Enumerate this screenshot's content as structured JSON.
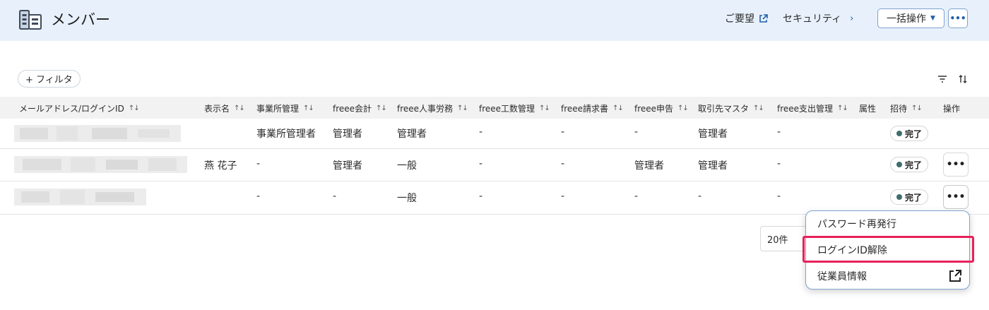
{
  "header": {
    "title": "メンバー",
    "request_label": "ご要望",
    "security_label": "セキュリティ",
    "bulk_label": "一括操作",
    "more_label": "•••"
  },
  "toolbar": {
    "filter_label": "+ フィルタ"
  },
  "table": {
    "columns": [
      {
        "label": "メールアドレス/ログインID",
        "sortable": true
      },
      {
        "label": "表示名",
        "sortable": true
      },
      {
        "label": "事業所管理",
        "sortable": true
      },
      {
        "label": "freee会計",
        "sortable": true
      },
      {
        "label": "freee人事労務",
        "sortable": true
      },
      {
        "label": "freee工数管理",
        "sortable": true
      },
      {
        "label": "freee請求書",
        "sortable": true
      },
      {
        "label": "freee申告",
        "sortable": true
      },
      {
        "label": "取引先マスタ",
        "sortable": true
      },
      {
        "label": "freee支出管理",
        "sortable": true
      },
      {
        "label": "属性",
        "sortable": false
      },
      {
        "label": "招待",
        "sortable": true
      },
      {
        "label": "操作",
        "sortable": false
      }
    ],
    "rows": [
      {
        "name": "",
        "office": "事業所管理者",
        "accounting": "管理者",
        "hr": "管理者",
        "workload": "-",
        "invoice": "-",
        "tax": "-",
        "partner": "管理者",
        "expense": "-",
        "status": "完了"
      },
      {
        "name": "燕 花子",
        "office": "-",
        "accounting": "管理者",
        "hr": "一般",
        "workload": "-",
        "invoice": "-",
        "tax": "管理者",
        "partner": "管理者",
        "expense": "-",
        "status": "完了"
      },
      {
        "name": "",
        "office": "-",
        "accounting": "-",
        "hr": "一般",
        "workload": "-",
        "invoice": "-",
        "tax": "-",
        "partner": "-",
        "expense": "-",
        "status": "完了"
      }
    ],
    "row_more_label": "•••"
  },
  "pagination": {
    "per_page": "20件"
  },
  "context_menu": {
    "items": [
      "パスワード再発行",
      "ログインID解除",
      "従業員情報"
    ]
  },
  "colors": {
    "header_bg": "#e8f1fb",
    "accent": "#1f5fa8",
    "highlight": "#e8205a",
    "status_dot": "#3d6e6e"
  }
}
